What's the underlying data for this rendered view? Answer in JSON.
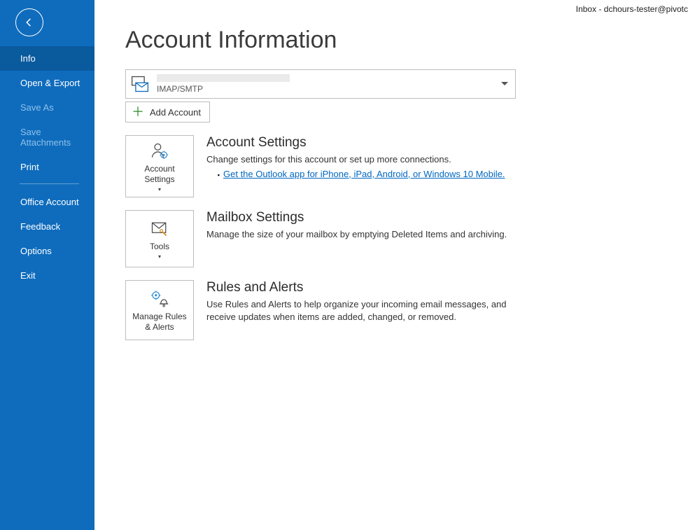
{
  "titlebar": "Inbox - dchours-tester@pivotc",
  "sidebar": {
    "items": [
      {
        "label": "Info",
        "state": "selected"
      },
      {
        "label": "Open & Export",
        "state": "normal"
      },
      {
        "label": "Save As",
        "state": "disabled"
      },
      {
        "label": "Save Attachments",
        "state": "disabled"
      },
      {
        "label": "Print",
        "state": "normal"
      },
      {
        "label": "Office Account",
        "state": "normal"
      },
      {
        "label": "Feedback",
        "state": "normal"
      },
      {
        "label": "Options",
        "state": "normal"
      },
      {
        "label": "Exit",
        "state": "normal"
      }
    ]
  },
  "page": {
    "title": "Account Information",
    "account_type": "IMAP/SMTP",
    "add_account": "Add Account"
  },
  "sections": {
    "account_settings": {
      "tile_label": "Account Settings",
      "title": "Account Settings",
      "desc": "Change settings for this account or set up more connections.",
      "link": "Get the Outlook app for iPhone, iPad, Android, or Windows 10 Mobile."
    },
    "mailbox": {
      "tile_label": "Tools",
      "title": "Mailbox Settings",
      "desc": "Manage the size of your mailbox by emptying Deleted Items and archiving."
    },
    "rules": {
      "tile_label": "Manage Rules & Alerts",
      "title": "Rules and Alerts",
      "desc": "Use Rules and Alerts to help organize your incoming email messages, and receive updates when items are added, changed, or removed."
    }
  }
}
